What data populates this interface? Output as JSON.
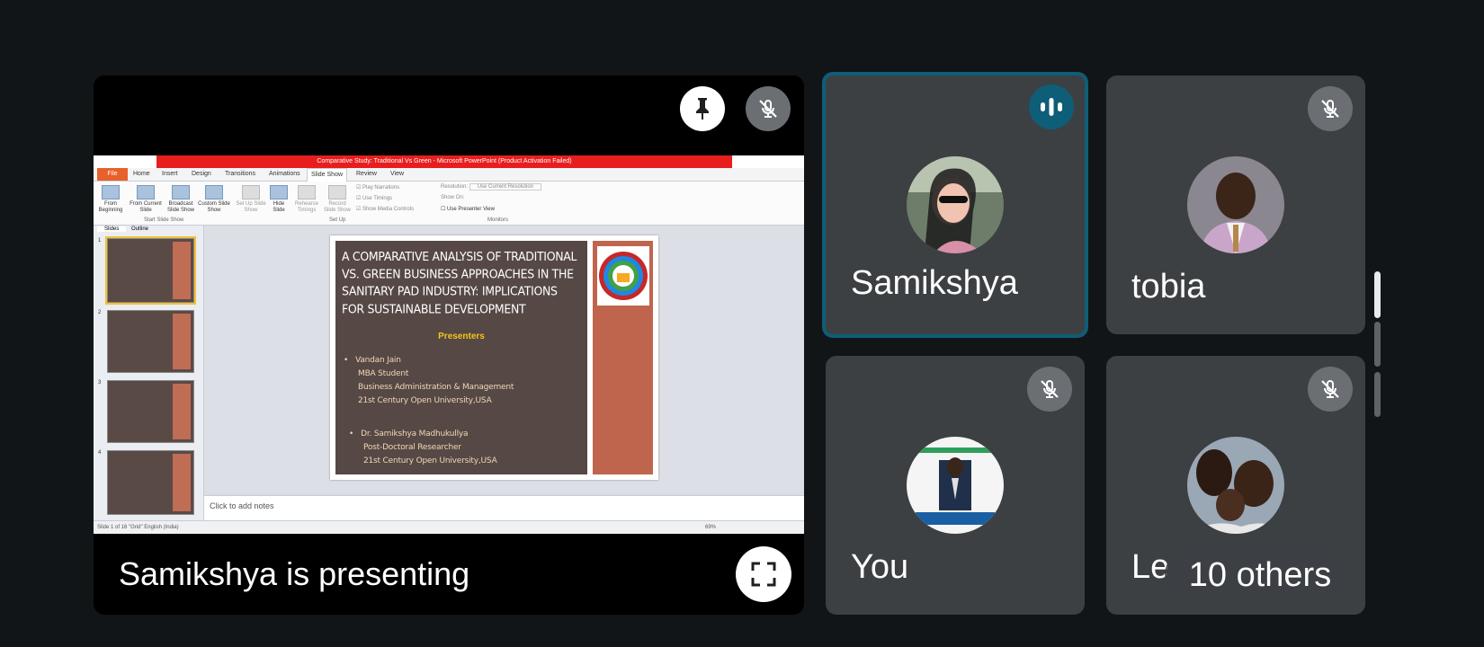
{
  "presentation": {
    "caption": "Samikshya is presenting",
    "ppt": {
      "window_title": "Comparative Study: Traditional Vs Green - Microsoft PowerPoint (Product Activation Failed)",
      "tabs": [
        "File",
        "Home",
        "Insert",
        "Design",
        "Transitions",
        "Animations",
        "Slide Show",
        "Review",
        "View"
      ],
      "active_tab": "Slide Show",
      "ribbon_buttons": [
        "From Beginning",
        "From Current Slide",
        "Broadcast Slide Show",
        "Custom Slide Show",
        "Set Up Slide Show",
        "Hide Slide",
        "Rehearse Timings",
        "Record Slide Show"
      ],
      "ribbon_groups": [
        "Start Slide Show",
        "Set Up",
        "Monitors"
      ],
      "checkboxes": [
        "Play Narrations",
        "Use Timings",
        "Show Media Controls",
        "Use Presenter View"
      ],
      "resolution_label": "Resolution:",
      "resolution_value": "Use Current Resolution",
      "show_on_label": "Show On:",
      "pane_tabs": [
        "Slides",
        "Outline"
      ],
      "thumb_numbers": [
        "1",
        "2",
        "3",
        "4"
      ],
      "notes_placeholder": "Click to add notes",
      "status_left": "Slide 1 of 16   \"Grid\"   English (India)",
      "zoom": "69%",
      "slide": {
        "title": "A COMPARATIVE ANALYSIS OF TRADITIONAL VS. GREEN BUSINESS APPROACHES IN THE SANITARY PAD INDUSTRY: IMPLICATIONS FOR SUSTAINABLE DEVELOPMENT",
        "presenters_heading": "Presenters",
        "p1_name": "Vandan Jain",
        "p1_l1": "MBA  Student",
        "p1_l2": "Business Administration  & Management",
        "p1_l3": "21st Century Open University,USA",
        "p2_name": "Dr. Samikshya Madhukullya",
        "p2_l1": "Post-Doctoral  Researcher",
        "p2_l2": "21st Century Open University,USA"
      }
    }
  },
  "participants": {
    "samikshya": "Samikshya",
    "tobia": "tobia",
    "you": "You",
    "fourth_partial": "Le",
    "others": "10 others"
  },
  "icons": {
    "pin": "pin-icon",
    "mic_off": "mic-off-icon",
    "speaking": "speaking-indicator-icon",
    "fullscreen": "fullscreen-icon"
  },
  "colors": {
    "bg": "#111518",
    "tile": "#3c4043",
    "active_border": "#0e5e78",
    "speaking": "#0e5e78"
  }
}
